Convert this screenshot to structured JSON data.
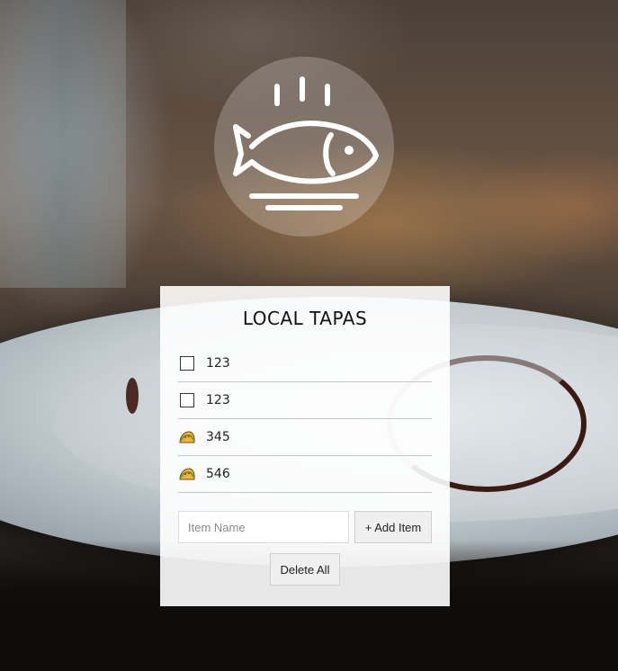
{
  "app": {
    "title": "LOCAL TAPAS"
  },
  "items": [
    {
      "label": "123",
      "state": "unchecked"
    },
    {
      "label": "123",
      "state": "unchecked"
    },
    {
      "label": "345",
      "state": "done",
      "icon": "taco-icon"
    },
    {
      "label": "546",
      "state": "done",
      "icon": "taco-icon"
    }
  ],
  "form": {
    "placeholder": "Item Name",
    "add_label": "+ Add Item",
    "delete_label": "Delete All"
  },
  "logo": {
    "icon": "steaming-fish-plate-icon"
  }
}
